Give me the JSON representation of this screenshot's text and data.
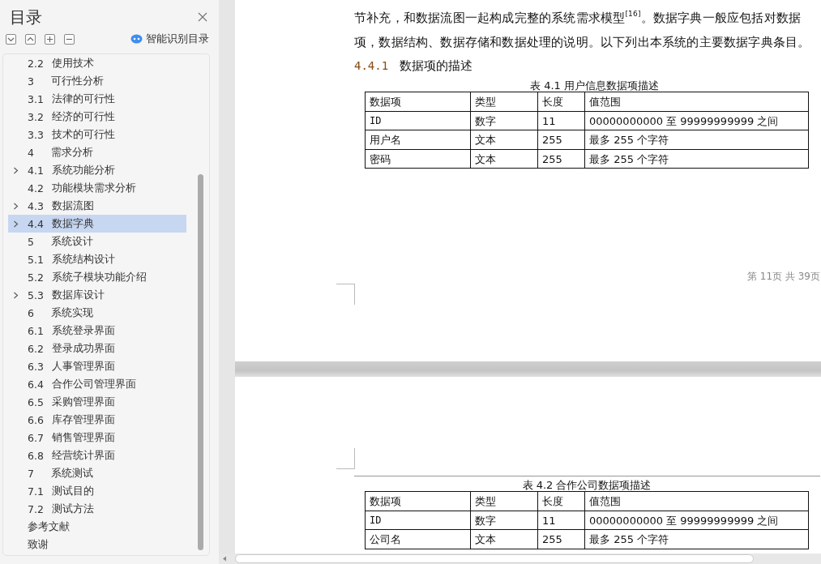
{
  "sidebar": {
    "title": "目录",
    "smart_button": "智能识别目录",
    "toc": [
      {
        "number": "2.2",
        "title": "使用技术",
        "expandable": false,
        "selected": false
      },
      {
        "number": "3",
        "title": "可行性分析",
        "expandable": false,
        "selected": false
      },
      {
        "number": "3.1",
        "title": "法律的可行性",
        "expandable": false,
        "selected": false
      },
      {
        "number": "3.2",
        "title": "经济的可行性",
        "expandable": false,
        "selected": false
      },
      {
        "number": "3.3",
        "title": "技术的可行性",
        "expandable": false,
        "selected": false
      },
      {
        "number": "4",
        "title": "需求分析",
        "expandable": false,
        "selected": false
      },
      {
        "number": "4.1",
        "title": "系统功能分析",
        "expandable": true,
        "selected": false
      },
      {
        "number": "4.2",
        "title": "功能模块需求分析",
        "expandable": false,
        "selected": false
      },
      {
        "number": "4.3",
        "title": "数据流图",
        "expandable": true,
        "selected": false
      },
      {
        "number": "4.4",
        "title": "数据字典",
        "expandable": true,
        "selected": true
      },
      {
        "number": "5",
        "title": "系统设计",
        "expandable": false,
        "selected": false
      },
      {
        "number": "5.1",
        "title": "系统结构设计",
        "expandable": false,
        "selected": false
      },
      {
        "number": "5.2",
        "title": "系统子模块功能介绍",
        "expandable": false,
        "selected": false
      },
      {
        "number": "5.3",
        "title": "数据库设计",
        "expandable": true,
        "selected": false
      },
      {
        "number": "6",
        "title": "系统实现",
        "expandable": false,
        "selected": false
      },
      {
        "number": "6.1",
        "title": "系统登录界面",
        "expandable": false,
        "selected": false
      },
      {
        "number": "6.2",
        "title": "登录成功界面",
        "expandable": false,
        "selected": false
      },
      {
        "number": "6.3",
        "title": "人事管理界面",
        "expandable": false,
        "selected": false
      },
      {
        "number": "6.4",
        "title": "合作公司管理界面",
        "expandable": false,
        "selected": false
      },
      {
        "number": "6.5",
        "title": "采购管理界面",
        "expandable": false,
        "selected": false
      },
      {
        "number": "6.6",
        "title": "库存管理界面",
        "expandable": false,
        "selected": false
      },
      {
        "number": "6.7",
        "title": "销售管理界面",
        "expandable": false,
        "selected": false
      },
      {
        "number": "6.8",
        "title": "经营统计界面",
        "expandable": false,
        "selected": false
      },
      {
        "number": "7",
        "title": "系统测试",
        "expandable": false,
        "selected": false
      },
      {
        "number": "7.1",
        "title": "测试目的",
        "expandable": false,
        "selected": false
      },
      {
        "number": "7.2",
        "title": "测试方法",
        "expandable": false,
        "selected": false
      },
      {
        "title": "参考文献",
        "expandable": false,
        "selected": false
      },
      {
        "title": "致谢",
        "expandable": false,
        "selected": false
      }
    ]
  },
  "document": {
    "paragraph": "节补充，和数据流图一起构成完整的系统需求模型$^{[16]}$。数据字典一般应包括对数据项，数据结构、数据存储和数据处理的说明。以下列出本系统的主要数据字典条目。",
    "heading": {
      "number": "4.4.1",
      "title": "数据项的描述"
    },
    "page_footer": "第 11页  共 39页",
    "tables": [
      {
        "caption": "表 4.1 用户信息数据项描述",
        "columns": [
          "数据项",
          "类型",
          "长度",
          "值范围"
        ],
        "rows": [
          [
            "ID",
            "数字",
            "11",
            "00000000000 至 99999999999 之间"
          ],
          [
            "用户名",
            "文本",
            "255",
            "最多 255 个字符"
          ],
          [
            "密码",
            "文本",
            "255",
            "最多 255 个字符"
          ]
        ]
      },
      {
        "caption": "表 4.2 合作公司数据项描述",
        "columns": [
          "数据项",
          "类型",
          "长度",
          "值范围"
        ],
        "rows": [
          [
            "ID",
            "数字",
            "11",
            "00000000000 至 99999999999 之间"
          ],
          [
            "公司名",
            "文本",
            "255",
            "最多 255 个字符"
          ]
        ]
      }
    ]
  }
}
